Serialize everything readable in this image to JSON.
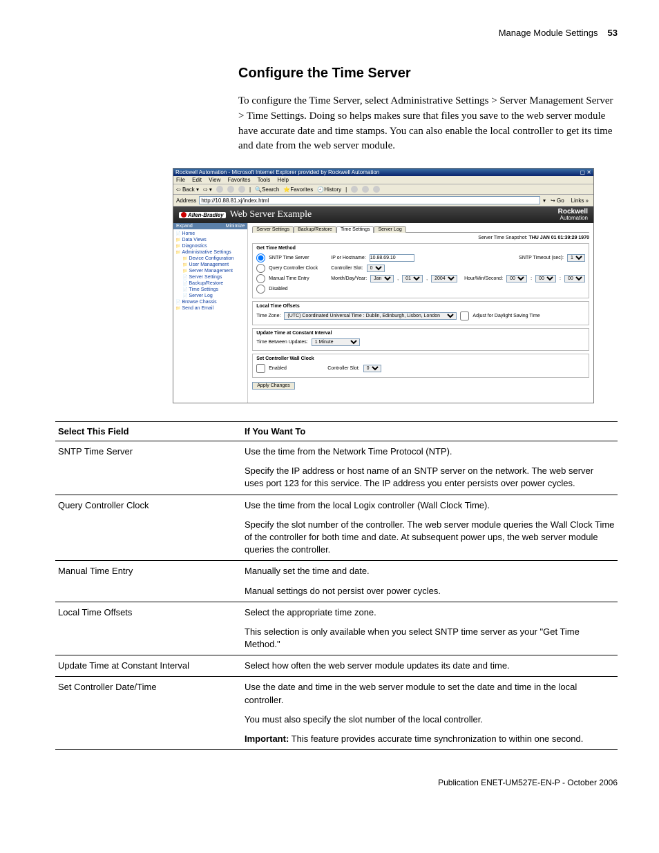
{
  "header": {
    "section": "Manage Module Settings",
    "page": "53"
  },
  "title": "Configure the Time Server",
  "intro": "To configure the Time Server, select Administrative Settings > Server Management Server > Time Settings. Doing so helps makes sure that files you save to the web server module have accurate date and time stamps. You can also enable the local controller to get its time and date from the web server module.",
  "screenshot": {
    "windowTitle": "Rockwell Automation - Microsoft Internet Explorer provided by Rockwell Automation",
    "menu": [
      "File",
      "Edit",
      "View",
      "Favorites",
      "Tools",
      "Help"
    ],
    "toolbar": {
      "back": "Back",
      "search": "Search",
      "favorites": "Favorites",
      "history": "History"
    },
    "address": {
      "label": "Address",
      "value": "http://10.88.81.xj/index.html",
      "go": "Go",
      "links": "Links"
    },
    "banner": {
      "brand": "Allen-Bradley",
      "title": "Web Server Example",
      "corp1": "Rockwell",
      "corp2": "Automation"
    },
    "side": {
      "expand": "Expand",
      "minimize": "Minimize",
      "items": [
        {
          "t": "Home",
          "c": "doc"
        },
        {
          "t": "Data Views",
          "c": ""
        },
        {
          "t": "Diagnostics",
          "c": ""
        },
        {
          "t": "Administrative Settings",
          "c": ""
        },
        {
          "t": "Device Configuration",
          "c": "ind"
        },
        {
          "t": "User Management",
          "c": "ind"
        },
        {
          "t": "Server Management",
          "c": "ind"
        },
        {
          "t": "Server Settings",
          "c": "ind doc"
        },
        {
          "t": "Backup/Restore",
          "c": "ind doc"
        },
        {
          "t": "Time Settings",
          "c": "ind doc"
        },
        {
          "t": "Server Log",
          "c": "ind doc"
        },
        {
          "t": "Browse Chassis",
          "c": "doc"
        },
        {
          "t": "Send an Email",
          "c": ""
        }
      ]
    },
    "tabs": [
      "Server Settings",
      "Backup/Restore",
      "Time Settings",
      "Server Log"
    ],
    "snapshot": {
      "label": "Server Time Snapshot:",
      "value": "THU JAN 01 01:39:29 1970"
    },
    "getTime": {
      "heading": "Get Time Method",
      "r1": {
        "opt": "SNTP Time Server",
        "ip": "IP or Hostname:",
        "ipval": "10.88.69.10",
        "timeout": "SNTP Timeout (sec):",
        "timeoutval": "1"
      },
      "r2": {
        "opt": "Query Controller Clock",
        "slot": "Controller Slot:",
        "slotval": "0"
      },
      "r3": {
        "opt": "Manual Time Entry",
        "mdy": "Month/Day/Year:",
        "m": "Jan",
        "d": "01",
        "y": "2004",
        "hms": "Hour/Min/Second:",
        "h": "00",
        "mi": "00",
        "s": "00"
      },
      "r4": {
        "opt": "Disabled"
      }
    },
    "local": {
      "heading": "Local Time Offsets",
      "tz": "Time Zone:",
      "tzval": "(UTC) Coordinated Universal Time : Dublin, Edinburgh, Lisbon, London",
      "dst": "Adjust for Daylight Saving Time"
    },
    "update": {
      "heading": "Update Time at Constant Interval",
      "label": "Time Between Updates:",
      "val": "1 Minute"
    },
    "setc": {
      "heading": "Set Controller Wall Clock",
      "en": "Enabled",
      "slot": "Controller Slot:",
      "slotval": "0"
    },
    "apply": "Apply Changes"
  },
  "table": {
    "h1": "Select This Field",
    "h2": "If You Want To",
    "rows": [
      {
        "f": "SNTP Time Server",
        "d": [
          "Use the time from the Network Time Protocol (NTP).",
          "Specify the IP address or host name of an SNTP server on the network. The web server uses port 123 for this service. The IP address you enter persists over power cycles."
        ]
      },
      {
        "f": "Query Controller Clock",
        "d": [
          "Use the time from the local Logix controller (Wall Clock Time).",
          "Specify the slot number of the controller. The web server module queries the Wall Clock Time of the controller for both time and date. At subsequent power ups, the web server module queries the controller."
        ]
      },
      {
        "f": "Manual Time Entry",
        "d": [
          "Manually set the time and date.",
          "Manual settings do not persist over power cycles."
        ]
      },
      {
        "f": "Local Time Offsets",
        "d": [
          "Select the appropriate time zone.",
          "This selection is only available when you select SNTP time server as your \"Get Time Method.\""
        ]
      },
      {
        "f": "Update Time at Constant Interval",
        "d": [
          "Select how often the web server module updates its date and time."
        ]
      },
      {
        "f": "Set Controller Date/Time",
        "d": [
          "Use the date and time in the web server module to set the date and time in the local controller.",
          "You must also specify the slot number of the local controller.",
          "<b>Important:</b> This feature provides accurate time synchronization to within one second."
        ]
      }
    ]
  },
  "footer": "Publication ENET-UM527E-EN-P - October 2006"
}
